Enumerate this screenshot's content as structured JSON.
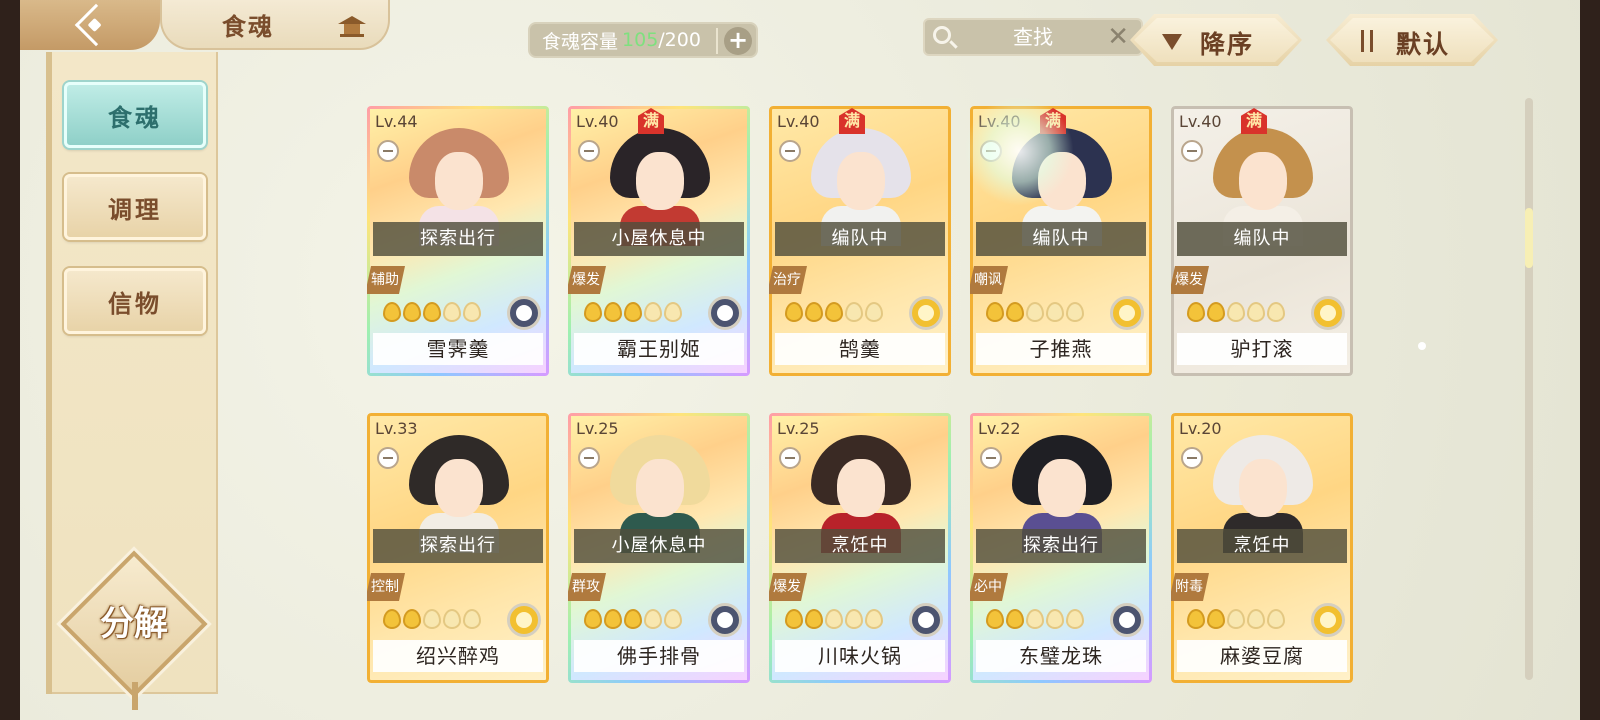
{
  "header": {
    "title": "食魂",
    "capacity_label": "食魂容量",
    "capacity_current": "105",
    "capacity_max": "/200",
    "search_placeholder": "查找",
    "sort_order_label": "降序",
    "sort_mode_label": "默认"
  },
  "sidebar": {
    "items": [
      {
        "label": "食魂",
        "active": true
      },
      {
        "label": "调理",
        "active": false
      },
      {
        "label": "信物",
        "active": false
      }
    ],
    "decompose_label": "分解"
  },
  "cards": [
    {
      "level": "Lv.44",
      "full": "",
      "status": "探索出行",
      "role": "辅助",
      "name": "雪霁羹",
      "stars_lit": 3,
      "element": "dark",
      "rarity": "rainbow",
      "hair": "#c98a6a",
      "outfit": "#f4e2e6"
    },
    {
      "level": "Lv.40",
      "full": "满",
      "status": "小屋休息中",
      "role": "爆发",
      "name": "霸王别姬",
      "stars_lit": 3,
      "element": "dark",
      "rarity": "rainbow",
      "hair": "#2a2428",
      "outfit": "#c23a32"
    },
    {
      "level": "Lv.40",
      "full": "满",
      "status": "编队中",
      "role": "治疗",
      "name": "鹄羹",
      "stars_lit": 3,
      "element": "gold",
      "rarity": "gold",
      "hair": "#e5e2ea",
      "outfit": "#f1f1ef"
    },
    {
      "level": "Lv.40",
      "full": "满",
      "status": "编队中",
      "role": "嘲讽",
      "name": "子推燕",
      "stars_lit": 2,
      "element": "gold",
      "rarity": "gold",
      "hair": "#2c3250",
      "outfit": "#f3f3f0"
    },
    {
      "level": "Lv.40",
      "full": "满",
      "status": "编队中",
      "role": "爆发",
      "name": "驴打滚",
      "stars_lit": 2,
      "element": "gold",
      "rarity": "silver",
      "hair": "#c4914d",
      "outfit": "#f4efe6"
    },
    {
      "level": "Lv.33",
      "full": "",
      "status": "探索出行",
      "role": "控制",
      "name": "绍兴醉鸡",
      "stars_lit": 2,
      "element": "gold",
      "rarity": "gold",
      "hair": "#2f2a28",
      "outfit": "#f2ede4"
    },
    {
      "level": "Lv.25",
      "full": "",
      "status": "小屋休息中",
      "role": "群攻",
      "name": "佛手排骨",
      "stars_lit": 3,
      "element": "dark",
      "rarity": "rainbow",
      "hair": "#f0da9c",
      "outfit": "#2e5a4e"
    },
    {
      "level": "Lv.25",
      "full": "",
      "status": "烹饪中",
      "role": "爆发",
      "name": "川味火锅",
      "stars_lit": 2,
      "element": "dark",
      "rarity": "rainbow",
      "hair": "#3a2a24",
      "outfit": "#b8222a"
    },
    {
      "level": "Lv.22",
      "full": "",
      "status": "探索出行",
      "role": "必中",
      "name": "东璧龙珠",
      "stars_lit": 2,
      "element": "dark",
      "rarity": "rainbow",
      "hair": "#1f1f24",
      "outfit": "#5a4f92"
    },
    {
      "level": "Lv.20",
      "full": "",
      "status": "烹饪中",
      "role": "附毒",
      "name": "麻婆豆腐",
      "stars_lit": 2,
      "element": "gold",
      "rarity": "gold",
      "hair": "#eeeae6",
      "outfit": "#2e2a2a"
    }
  ],
  "colors": {
    "accent_teal": "#8fd0c8",
    "panel_cream": "#f3e7c8",
    "brown_text": "#7a4d2c",
    "status_overlay": "#504e3c",
    "capacity_green": "#7fe07f"
  }
}
